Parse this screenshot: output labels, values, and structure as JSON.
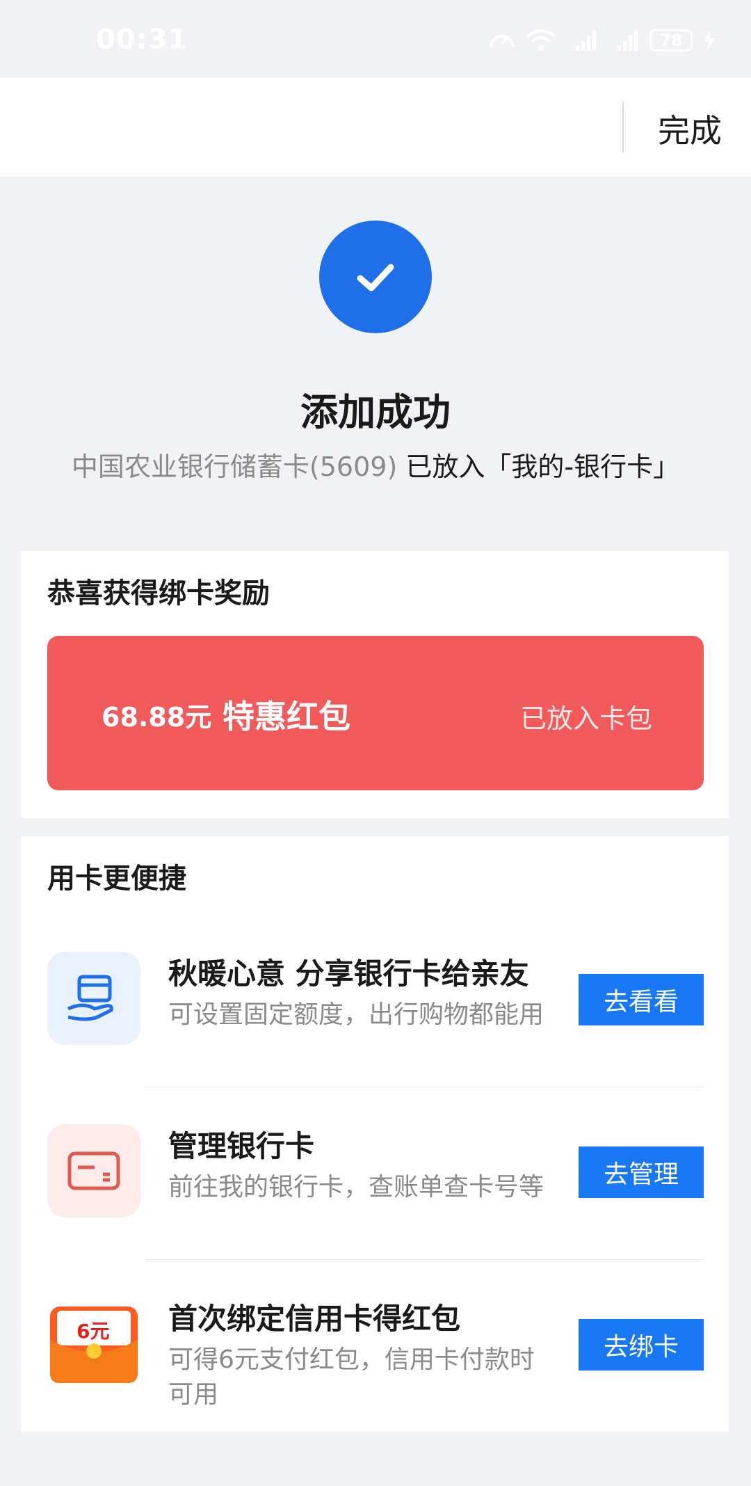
{
  "status_bar": {
    "time": "00:31",
    "battery": "78",
    "icons": [
      "speed-icon",
      "wifi-icon",
      "signal-4g-icon",
      "signal-4g-icon",
      "charging-icon"
    ]
  },
  "header": {
    "done_label": "完成"
  },
  "success": {
    "title": "添加成功",
    "desc_card": "中国农业银行储蓄卡(5609)",
    "desc_action": " 已放入「我的-银行卡」"
  },
  "reward": {
    "section_title": "恭喜获得绑卡奖励",
    "amount": "68.88元",
    "name": "特惠红包",
    "status": "已放入卡包",
    "banner_color": "#f05a5a"
  },
  "services": {
    "section_title": "用卡更便捷",
    "items": [
      {
        "title": "秋暖心意 分享银行卡给亲友",
        "desc": "可设置固定额度，出行购物都能用",
        "button": "去看看",
        "icon": "share-card-hand-icon"
      },
      {
        "title": "管理银行卡",
        "desc": "前往我的银行卡，查账单查卡号等",
        "button": "去管理",
        "icon": "bank-card-icon"
      },
      {
        "title": "首次绑定信用卡得红包",
        "desc": "可得6元支付红包，信用卡付款时可用",
        "button": "去绑卡",
        "icon": "red-envelope-icon",
        "icon_text": "6元"
      }
    ]
  },
  "colors": {
    "accent": "#1877f2",
    "success": "#1f6fe8",
    "background": "#f1f2f6"
  }
}
